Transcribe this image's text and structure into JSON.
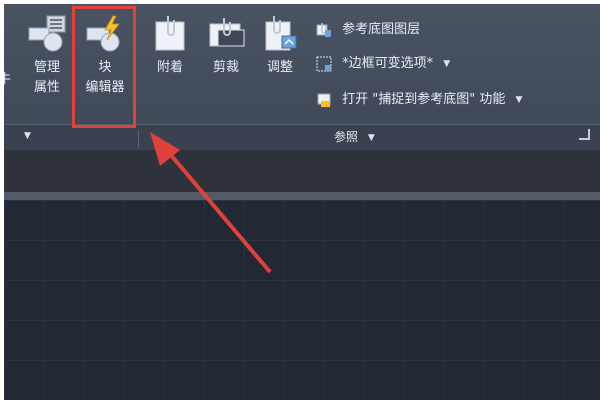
{
  "ribbon": {
    "left_edge_fragment": "牛",
    "buttons": {
      "manage_attributes": {
        "label_line1": "管理",
        "label_line2": "属性"
      },
      "block_editor": {
        "label_line1": "块",
        "label_line2": "编辑器"
      },
      "attach": {
        "label": "附着"
      },
      "clip": {
        "label": "剪裁"
      },
      "adjust": {
        "label": "调整"
      }
    },
    "small_items": {
      "underlay_layers": "参考底图图层",
      "frame_variable": "*边框可变选项*",
      "snap_underlay": "打开 \"捕捉到参考底图\" 功能"
    }
  },
  "groups": {
    "reference": {
      "label": "参照"
    }
  },
  "colors": {
    "highlight": "#e0413a",
    "ribbon_bg": "#434c5b",
    "canvas_bg": "#222935"
  },
  "icons": [
    "block-editor-icon",
    "manage-attributes-icon",
    "attach-icon",
    "clip-icon",
    "adjust-icon",
    "underlay-layers-icon",
    "frame-variable-icon",
    "snap-underlay-icon",
    "panel-launcher-icon"
  ]
}
